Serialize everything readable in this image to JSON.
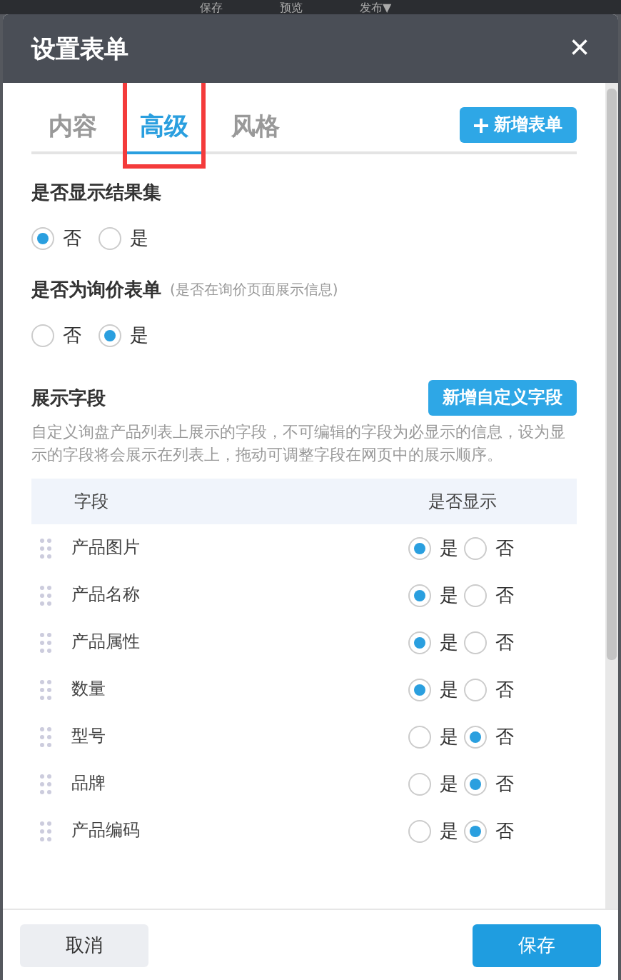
{
  "topbar": {
    "items": [
      "保存",
      "预览",
      "发布▼"
    ]
  },
  "dialog": {
    "title": "设置表单",
    "close": "×"
  },
  "tabs": [
    {
      "label": "内容",
      "selected": false,
      "highlighted": false
    },
    {
      "label": "高级",
      "selected": true,
      "highlighted": true
    },
    {
      "label": "风格",
      "selected": false,
      "highlighted": false
    }
  ],
  "add_form_button": "新增表单",
  "sections": [
    {
      "title": "是否显示结果集",
      "options": [
        {
          "label": "否",
          "selected": true
        },
        {
          "label": "是",
          "selected": false
        }
      ]
    },
    {
      "title": "是否为询价表单",
      "note": "(是否在询价页面展示信息)",
      "options": [
        {
          "label": "否",
          "selected": false
        },
        {
          "label": "是",
          "selected": true
        }
      ]
    }
  ],
  "fields_section": {
    "title": "展示字段",
    "button": "新增自定义字段",
    "description": "自定义询盘产品列表上展示的字段，不可编辑的字段为必显示的信息，设为显示的字段将会展示在列表上，拖动可调整字段在网页中的展示顺序。",
    "columns": [
      "字段",
      "是否显示"
    ],
    "rows": [
      {
        "name": "产品图片",
        "yes": "是",
        "no": "否",
        "shown": true
      },
      {
        "name": "产品名称",
        "yes": "是",
        "no": "否",
        "shown": true
      },
      {
        "name": "产品属性",
        "yes": "是",
        "no": "否",
        "shown": true
      },
      {
        "name": "数量",
        "yes": "是",
        "no": "否",
        "shown": true
      },
      {
        "name": "型号",
        "yes": "是",
        "no": "否",
        "shown": false
      },
      {
        "name": "品牌",
        "yes": "是",
        "no": "否",
        "shown": false
      },
      {
        "name": "产品编码",
        "yes": "是",
        "no": "否",
        "shown": false
      }
    ]
  },
  "footer": {
    "cancel": "取消",
    "save": "保存"
  }
}
